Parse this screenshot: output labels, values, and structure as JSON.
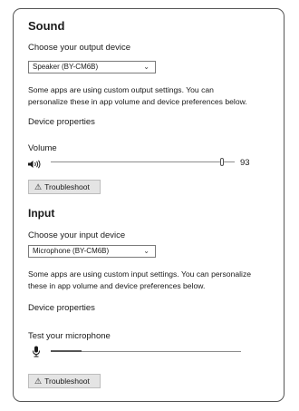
{
  "sound": {
    "title": "Sound",
    "output_label": "Choose your output device",
    "output_device": "Speaker (BY-CM6B)",
    "output_desc": "Some apps are using custom output settings. You can personalize these in app volume and device preferences below.",
    "device_properties": "Device properties",
    "volume_label": "Volume",
    "volume_value": "93",
    "volume_level": 0.93,
    "troubleshoot": "Troubleshoot"
  },
  "input": {
    "title": "Input",
    "input_label": "Choose your input device",
    "input_device": "Microphone (BY-CM6B)",
    "input_desc": "Some apps are using custom input settings. You can personalize these in app volume and device preferences below.",
    "device_properties": "Device properties",
    "test_label": "Test your microphone",
    "mic_level": 0.16,
    "troubleshoot": "Troubleshoot"
  },
  "icons": {
    "speaker": "speaker-icon",
    "microphone": "microphone-icon",
    "warning": "warning-icon",
    "chevron": "chevron-down-icon"
  }
}
